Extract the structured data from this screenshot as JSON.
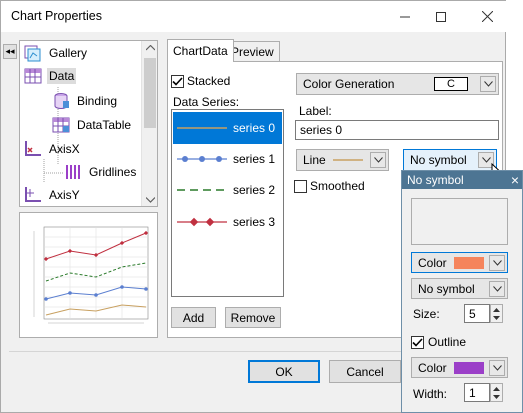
{
  "window": {
    "title": "Chart Properties"
  },
  "titlebar_buttons": [
    "minimize-icon",
    "maximize-icon",
    "close-icon"
  ],
  "sidebar": {
    "collapse_glyph": "◂◂",
    "tree": [
      {
        "label": "Gallery",
        "icon": "gallery-icon"
      },
      {
        "label": "Data",
        "icon": "data-icon",
        "selected": true
      },
      {
        "label": "Binding",
        "icon": "binding-icon"
      },
      {
        "label": "DataTable",
        "icon": "datatable-icon"
      },
      {
        "label": "AxisX",
        "icon": "axisx-icon"
      },
      {
        "label": "Gridlines",
        "icon": "gridlines-icon"
      },
      {
        "label": "AxisY",
        "icon": "axisy-icon"
      }
    ]
  },
  "tabs": [
    {
      "label": "ChartData",
      "active": true
    },
    {
      "label": "Preview",
      "active": false
    }
  ],
  "chartdata": {
    "stacked_label": "Stacked",
    "stacked_checked": true,
    "series_header": "Data Series:",
    "series": [
      {
        "label": "series 0",
        "color": "#c8a060",
        "marker": "none",
        "dash": "solid"
      },
      {
        "label": "series 1",
        "color": "#5b7fd0",
        "marker": "circle",
        "dash": "solid"
      },
      {
        "label": "series 2",
        "color": "#2a7a2a",
        "marker": "none",
        "dash": "dashed"
      },
      {
        "label": "series 3",
        "color": "#c03040",
        "marker": "diamond",
        "dash": "solid"
      }
    ],
    "add_label": "Add",
    "remove_label": "Remove",
    "color_generation_label": "Color Generation",
    "color_generation_value": "C",
    "label_caption": "Label:",
    "label_value": "series 0",
    "line_style_label": "Line",
    "symbol_label": "No symbol",
    "smoothed_label": "Smoothed",
    "smoothed_checked": false
  },
  "popup": {
    "title": "No symbol",
    "close_glyph": "×",
    "color1_label": "Color",
    "color1": "#f5845c",
    "symbol_label": "No symbol",
    "size_label": "Size:",
    "size_value": "5",
    "outline_label": "Outline",
    "outline_checked": true,
    "color2_label": "Color",
    "color2": "#9b3fc8",
    "width_label": "Width:",
    "width_value": "1"
  },
  "footer": {
    "ok_label": "OK",
    "cancel_label": "Cancel"
  }
}
